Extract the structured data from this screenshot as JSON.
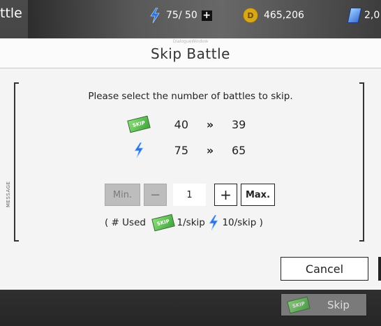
{
  "topbar": {
    "title": "ttle",
    "stamina": "75/ 50",
    "coins": "465,206",
    "gems": "2,0"
  },
  "dialog": {
    "caption": "DialogueWindow",
    "title": "Skip Battle",
    "instruction": "Please select the number of battles to skip.",
    "message_label": "MESSAGE",
    "skip_tickets": {
      "from": "40",
      "arrow": "»",
      "to": "39"
    },
    "stamina": {
      "from": "75",
      "arrow": "»",
      "to": "65"
    },
    "controls": {
      "min_label": "Min.",
      "decrement_label": "−",
      "quantity": "1",
      "increment_label": "+",
      "max_label": "Max."
    },
    "used": {
      "prefix": "( # Used ",
      "ticket_cost": " 1/skip ",
      "stamina_cost": " 10/skip )"
    },
    "cancel_label": "Cancel",
    "ticket_text": "SKIP"
  },
  "footer": {
    "skip_label": "Skip"
  },
  "colors": {
    "ticket_green": "#5cc24f",
    "bolt_blue": "#2f6fe0",
    "coin_gold": "#d8a81c"
  }
}
